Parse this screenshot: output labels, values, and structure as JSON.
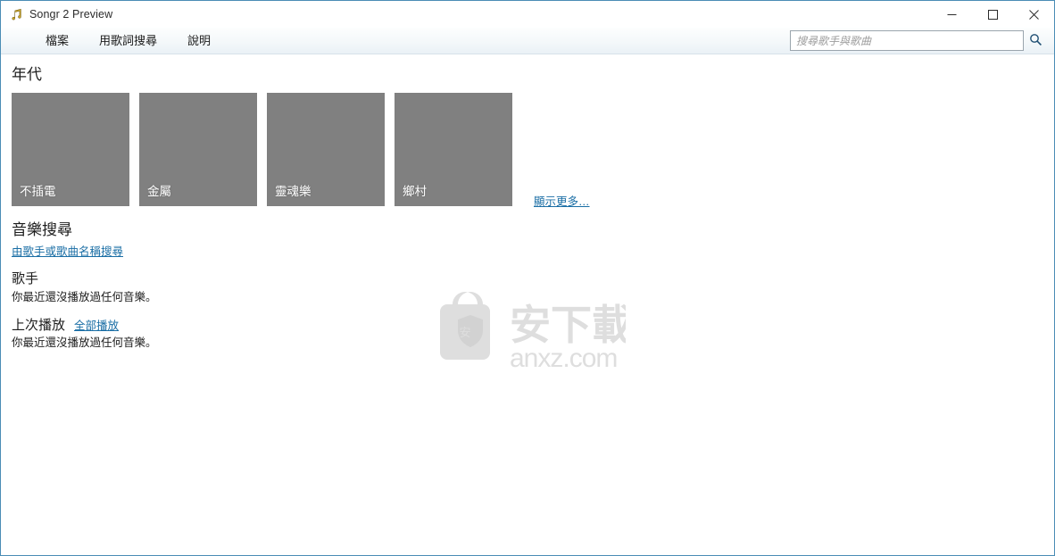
{
  "window": {
    "title": "Songr 2 Preview",
    "app_icon": "music-note-icon",
    "controls": {
      "minimize": "minimize-icon",
      "maximize": "maximize-icon",
      "close": "close-icon"
    }
  },
  "menu": {
    "items": [
      {
        "label": "檔案"
      },
      {
        "label": "用歌詞搜尋"
      },
      {
        "label": "說明"
      }
    ]
  },
  "search": {
    "placeholder": "搜尋歌手與歌曲",
    "value": "",
    "icon": "search-icon"
  },
  "genres": {
    "title": "年代",
    "tiles": [
      {
        "label": "不插電",
        "color": "#808080"
      },
      {
        "label": "金屬",
        "color": "#808080"
      },
      {
        "label": "靈魂樂",
        "color": "#808080"
      },
      {
        "label": "鄉村",
        "color": "#808080"
      }
    ],
    "show_more": "顯示更多…"
  },
  "music_search": {
    "title": "音樂搜尋",
    "link": "由歌手或歌曲名稱搜尋"
  },
  "artists": {
    "title": "歌手",
    "empty_message": "你最近還沒播放過任何音樂。"
  },
  "last_played": {
    "title": "上次播放",
    "play_all_link": "全部播放",
    "empty_message": "你最近還沒播放過任何音樂。"
  },
  "watermark": {
    "text": "anxz.com",
    "logo_text": "安下載",
    "color": "#dcdcdc"
  },
  "colors": {
    "window_border": "#4b8db5",
    "link": "#1a6ea5",
    "tile": "#808080",
    "background": "#ffffff"
  }
}
